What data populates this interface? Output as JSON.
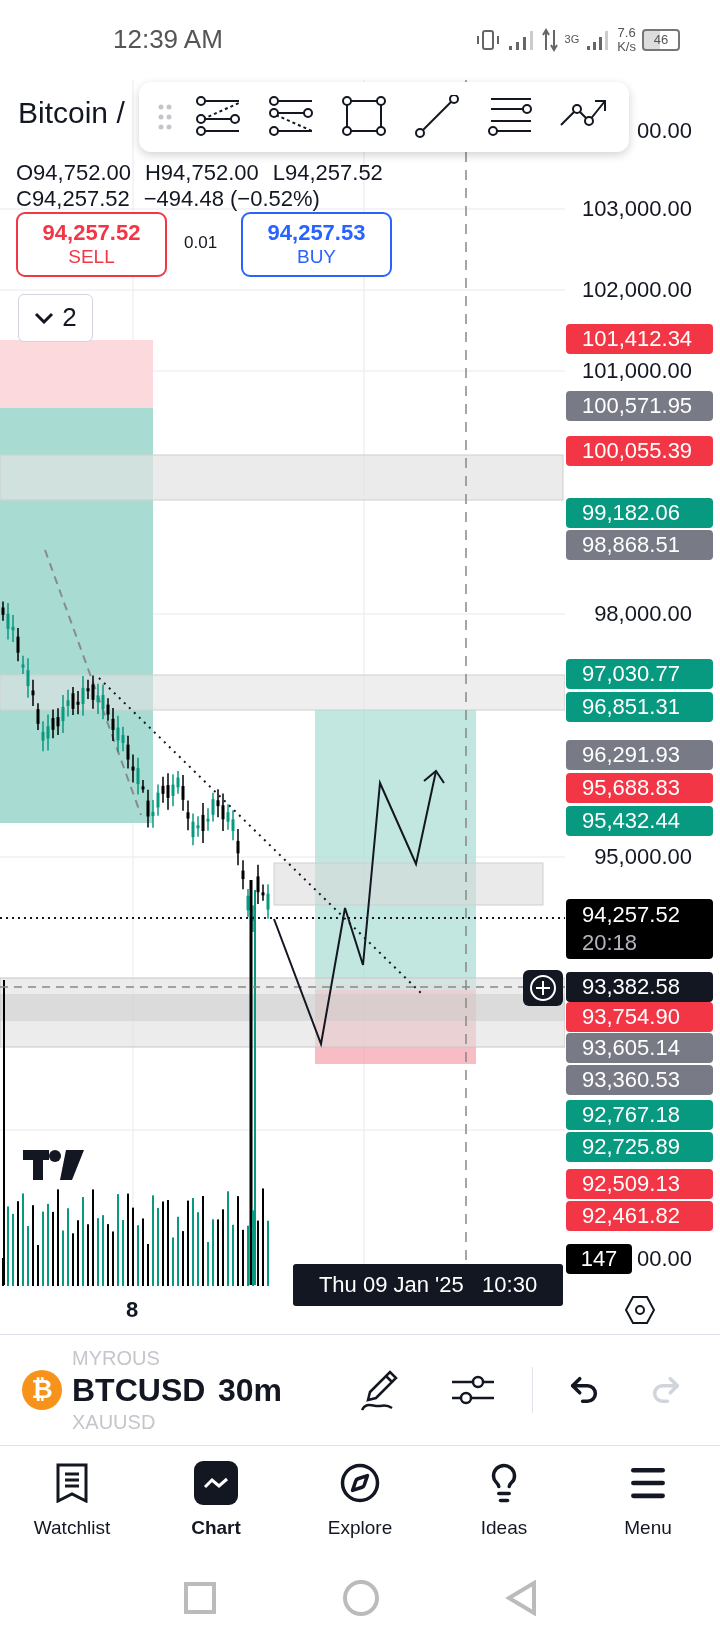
{
  "status_bar": {
    "time": "12:39 AM",
    "network": "3G",
    "speed": "7.6",
    "speed_unit": "K/s",
    "battery": "46"
  },
  "chart": {
    "title": "Bitcoin /",
    "ohlc": [
      "O94,752.00",
      "H94,752.00",
      "L94,257.52"
    ],
    "close_line": [
      "C94,257.52",
      "−494.48 (−0.52%)"
    ],
    "sell": {
      "price": "94,257.52",
      "label": "SELL"
    },
    "spread": "0.01",
    "buy": {
      "price": "94,257.53",
      "label": "BUY"
    },
    "collapse_count": "2",
    "price_labels": [
      {
        "kind": "scale",
        "text": "00.00"
      },
      {
        "kind": "scale",
        "text": "103,000.00"
      },
      {
        "kind": "scale",
        "text": "102,000.00"
      },
      {
        "kind": "marker",
        "text": "101,412.34",
        "color": "#f23645"
      },
      {
        "kind": "scale",
        "text": "101,000.00"
      },
      {
        "kind": "marker",
        "text": "100,571.95",
        "color": "#787b86"
      },
      {
        "kind": "marker",
        "text": "100,055.39",
        "color": "#f23645"
      },
      {
        "kind": "marker",
        "text": "99,182.06",
        "color": "#089981"
      },
      {
        "kind": "marker",
        "text": "98,868.51",
        "color": "#787b86"
      },
      {
        "kind": "scale",
        "text": "98,000.00"
      },
      {
        "kind": "marker",
        "text": "97,030.77",
        "color": "#089981"
      },
      {
        "kind": "marker",
        "text": "96,851.31",
        "color": "#089981"
      },
      {
        "kind": "marker",
        "text": "96,291.93",
        "color": "#787b86"
      },
      {
        "kind": "marker",
        "text": "95,688.83",
        "color": "#f23645"
      },
      {
        "kind": "marker",
        "text": "95,432.44",
        "color": "#089981"
      },
      {
        "kind": "scale",
        "text": "95,000.00"
      },
      {
        "kind": "last",
        "text": "94,257.52",
        "countdown": "20:18"
      },
      {
        "kind": "crosshair",
        "text": "93,382.58"
      },
      {
        "kind": "marker",
        "text": "93,754.90",
        "color": "#f23645"
      },
      {
        "kind": "marker",
        "text": "93,605.14",
        "color": "#787b86"
      },
      {
        "kind": "marker",
        "text": "93,360.53",
        "color": "#787b86"
      },
      {
        "kind": "marker",
        "text": "92,767.18",
        "color": "#089981"
      },
      {
        "kind": "marker",
        "text": "92,725.89",
        "color": "#089981"
      },
      {
        "kind": "marker",
        "text": "92,509.13",
        "color": "#f23645"
      },
      {
        "kind": "marker",
        "text": "92,461.82",
        "color": "#f23645"
      }
    ],
    "volume_label": "147",
    "volume_scale_label": "00.00",
    "time_label": "8",
    "crosshair_time": "Thu 09 Jan '25   10:30"
  },
  "bottom_bar": {
    "coin_glyph": "₿",
    "symbol_above": "MYROUS",
    "symbol": "BTCUSD",
    "symbol_below": "XAUUSD",
    "interval": "30m",
    "redo_disabled": true
  },
  "nav": [
    {
      "label": "Watchlist",
      "selected": false
    },
    {
      "label": "Chart",
      "selected": true
    },
    {
      "label": "Explore",
      "selected": false
    },
    {
      "label": "Ideas",
      "selected": false
    },
    {
      "label": "Menu",
      "selected": false
    }
  ]
}
